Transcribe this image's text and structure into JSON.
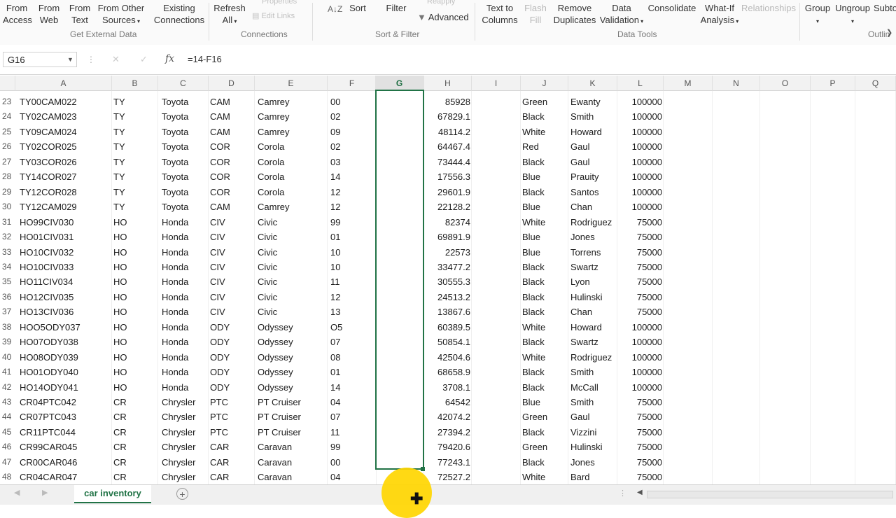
{
  "ribbon": {
    "from_access": [
      "From",
      "Access"
    ],
    "from_web": [
      "From",
      "Web"
    ],
    "from_text": [
      "From",
      "Text"
    ],
    "from_other": [
      "From Other",
      "Sources"
    ],
    "existing": [
      "Existing",
      "Connections"
    ],
    "refresh": [
      "Refresh",
      "All"
    ],
    "properties": "Properties",
    "edit_links": "Edit Links",
    "sort_az": "A↓Z",
    "sort": "Sort",
    "filter": "Filter",
    "reapply": "Reapply",
    "advanced": "Advanced",
    "text_to_columns": [
      "Text to",
      "Columns"
    ],
    "flash_fill": [
      "Flash",
      "Fill"
    ],
    "remove_dup": [
      "Remove",
      "Duplicates"
    ],
    "data_validation": [
      "Data",
      "Validation"
    ],
    "consolidate": "Consolidate",
    "what_if": [
      "What-If",
      "Analysis"
    ],
    "relationships": "Relationships",
    "group": "Group",
    "ungroup": "Ungroup",
    "subtotal": "Subto",
    "groups": {
      "external": "Get External Data",
      "connections": "Connections",
      "sort_filter": "Sort & Filter",
      "data_tools": "Data Tools",
      "outline": "Outlin"
    }
  },
  "formula_bar": {
    "name_box": "G16",
    "fx": "fx",
    "cancel": "✕",
    "enter": "✓",
    "formula": "=14-F16"
  },
  "columns": [
    "A",
    "B",
    "C",
    "D",
    "E",
    "F",
    "G",
    "H",
    "I",
    "J",
    "K",
    "L",
    "M",
    "N",
    "O",
    "P",
    "Q"
  ],
  "rows": [
    {
      "n": "23",
      "a": "TY00CAM022",
      "b": "TY",
      "c": "Toyota",
      "d": "CAM",
      "e": "Camrey",
      "f": "00",
      "h": "85928",
      "j": "Green",
      "k": "Ewanty",
      "l": "100000"
    },
    {
      "n": "24",
      "a": "TY02CAM023",
      "b": "TY",
      "c": "Toyota",
      "d": "CAM",
      "e": "Camrey",
      "f": "02",
      "h": "67829.1",
      "j": "Black",
      "k": "Smith",
      "l": "100000"
    },
    {
      "n": "25",
      "a": "TY09CAM024",
      "b": "TY",
      "c": "Toyota",
      "d": "CAM",
      "e": "Camrey",
      "f": "09",
      "h": "48114.2",
      "j": "White",
      "k": "Howard",
      "l": "100000"
    },
    {
      "n": "26",
      "a": "TY02COR025",
      "b": "TY",
      "c": "Toyota",
      "d": "COR",
      "e": "Corola",
      "f": "02",
      "h": "64467.4",
      "j": "Red",
      "k": "Gaul",
      "l": "100000"
    },
    {
      "n": "27",
      "a": "TY03COR026",
      "b": "TY",
      "c": "Toyota",
      "d": "COR",
      "e": "Corola",
      "f": "03",
      "h": "73444.4",
      "j": "Black",
      "k": "Gaul",
      "l": "100000"
    },
    {
      "n": "28",
      "a": "TY14COR027",
      "b": "TY",
      "c": "Toyota",
      "d": "COR",
      "e": "Corola",
      "f": "14",
      "h": "17556.3",
      "j": "Blue",
      "k": "Prauity",
      "l": "100000"
    },
    {
      "n": "29",
      "a": "TY12COR028",
      "b": "TY",
      "c": "Toyota",
      "d": "COR",
      "e": "Corola",
      "f": "12",
      "h": "29601.9",
      "j": "Black",
      "k": "Santos",
      "l": "100000"
    },
    {
      "n": "30",
      "a": "TY12CAM029",
      "b": "TY",
      "c": "Toyota",
      "d": "CAM",
      "e": "Camrey",
      "f": "12",
      "h": "22128.2",
      "j": "Blue",
      "k": "Chan",
      "l": "100000"
    },
    {
      "n": "31",
      "a": "HO99CIV030",
      "b": "HO",
      "c": "Honda",
      "d": "CIV",
      "e": "Civic",
      "f": "99",
      "h": "82374",
      "j": "White",
      "k": "Rodriguez",
      "l": "75000"
    },
    {
      "n": "32",
      "a": "HO01CIV031",
      "b": "HO",
      "c": "Honda",
      "d": "CIV",
      "e": "Civic",
      "f": "01",
      "h": "69891.9",
      "j": "Blue",
      "k": "Jones",
      "l": "75000"
    },
    {
      "n": "33",
      "a": "HO10CIV032",
      "b": "HO",
      "c": "Honda",
      "d": "CIV",
      "e": "Civic",
      "f": "10",
      "h": "22573",
      "j": "Blue",
      "k": "Torrens",
      "l": "75000"
    },
    {
      "n": "34",
      "a": "HO10CIV033",
      "b": "HO",
      "c": "Honda",
      "d": "CIV",
      "e": "Civic",
      "f": "10",
      "h": "33477.2",
      "j": "Black",
      "k": "Swartz",
      "l": "75000"
    },
    {
      "n": "35",
      "a": "HO11CIV034",
      "b": "HO",
      "c": "Honda",
      "d": "CIV",
      "e": "Civic",
      "f": "11",
      "h": "30555.3",
      "j": "Black",
      "k": "Lyon",
      "l": "75000"
    },
    {
      "n": "36",
      "a": "HO12CIV035",
      "b": "HO",
      "c": "Honda",
      "d": "CIV",
      "e": "Civic",
      "f": "12",
      "h": "24513.2",
      "j": "Black",
      "k": "Hulinski",
      "l": "75000"
    },
    {
      "n": "37",
      "a": "HO13CIV036",
      "b": "HO",
      "c": "Honda",
      "d": "CIV",
      "e": "Civic",
      "f": "13",
      "h": "13867.6",
      "j": "Black",
      "k": "Chan",
      "l": "75000"
    },
    {
      "n": "38",
      "a": "HOO5ODY037",
      "b": "HO",
      "c": "Honda",
      "d": "ODY",
      "e": "Odyssey",
      "f": "O5",
      "h": "60389.5",
      "j": "White",
      "k": "Howard",
      "l": "100000"
    },
    {
      "n": "39",
      "a": "HO07ODY038",
      "b": "HO",
      "c": "Honda",
      "d": "ODY",
      "e": "Odyssey",
      "f": "07",
      "h": "50854.1",
      "j": "Black",
      "k": "Swartz",
      "l": "100000"
    },
    {
      "n": "40",
      "a": "HO08ODY039",
      "b": "HO",
      "c": "Honda",
      "d": "ODY",
      "e": "Odyssey",
      "f": "08",
      "h": "42504.6",
      "j": "White",
      "k": "Rodriguez",
      "l": "100000"
    },
    {
      "n": "41",
      "a": "HO01ODY040",
      "b": "HO",
      "c": "Honda",
      "d": "ODY",
      "e": "Odyssey",
      "f": "01",
      "h": "68658.9",
      "j": "Black",
      "k": "Smith",
      "l": "100000"
    },
    {
      "n": "42",
      "a": "HO14ODY041",
      "b": "HO",
      "c": "Honda",
      "d": "ODY",
      "e": "Odyssey",
      "f": "14",
      "h": "3708.1",
      "j": "Black",
      "k": "McCall",
      "l": "100000"
    },
    {
      "n": "43",
      "a": "CR04PTC042",
      "b": "CR",
      "c": "Chrysler",
      "d": "PTC",
      "e": "PT Cruiser",
      "f": "04",
      "h": "64542",
      "j": "Blue",
      "k": "Smith",
      "l": "75000"
    },
    {
      "n": "44",
      "a": "CR07PTC043",
      "b": "CR",
      "c": "Chrysler",
      "d": "PTC",
      "e": "PT Cruiser",
      "f": "07",
      "h": "42074.2",
      "j": "Green",
      "k": "Gaul",
      "l": "75000"
    },
    {
      "n": "45",
      "a": "CR11PTC044",
      "b": "CR",
      "c": "Chrysler",
      "d": "PTC",
      "e": "PT Cruiser",
      "f": "11",
      "h": "27394.2",
      "j": "Black",
      "k": "Vizzini",
      "l": "75000"
    },
    {
      "n": "46",
      "a": "CR99CAR045",
      "b": "CR",
      "c": "Chrysler",
      "d": "CAR",
      "e": "Caravan",
      "f": "99",
      "h": "79420.6",
      "j": "Green",
      "k": "Hulinski",
      "l": "75000"
    },
    {
      "n": "47",
      "a": "CR00CAR046",
      "b": "CR",
      "c": "Chrysler",
      "d": "CAR",
      "e": "Caravan",
      "f": "00",
      "h": "77243.1",
      "j": "Black",
      "k": "Jones",
      "l": "75000"
    },
    {
      "n": "48",
      "a": "CR04CAR047",
      "b": "CR",
      "c": "Chrysler",
      "d": "CAR",
      "e": "Caravan",
      "f": "04",
      "h": "72527.2",
      "j": "White",
      "k": "Bard",
      "l": "75000"
    }
  ],
  "sheet_tab": "car inventory",
  "add_sheet": "+",
  "colors": {
    "accent": "#217346",
    "cursor_highlight": "#ffd600"
  }
}
